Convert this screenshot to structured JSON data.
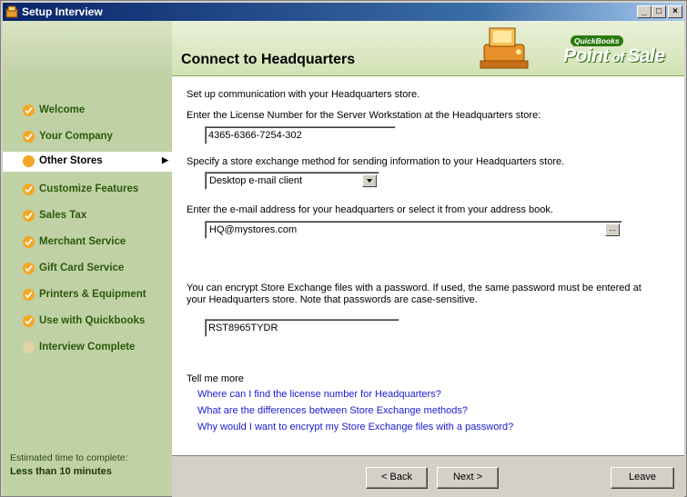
{
  "window": {
    "title": "Setup Interview",
    "minimize": "_",
    "maximize": "□",
    "close": "×"
  },
  "sidebar": {
    "items": [
      {
        "label": "Welcome",
        "state": "done"
      },
      {
        "label": "Your Company",
        "state": "done"
      },
      {
        "label": "Other Stores",
        "state": "active"
      },
      {
        "label": "Customize Features",
        "state": "done"
      },
      {
        "label": "Sales Tax",
        "state": "done"
      },
      {
        "label": "Merchant Service",
        "state": "done"
      },
      {
        "label": "Gift Card Service",
        "state": "done"
      },
      {
        "label": "Printers & Equipment",
        "state": "done"
      },
      {
        "label": "Use with Quickbooks",
        "state": "done"
      },
      {
        "label": "Interview Complete",
        "state": "pending"
      }
    ],
    "estimate_label": "Estimated time to complete:",
    "estimate_value": "Less than 10 minutes"
  },
  "header": {
    "title": "Connect to Headquarters",
    "brand_top": "QuickBooks",
    "brand_main_1": "Point",
    "brand_main_2": " of ",
    "brand_main_3": "Sale"
  },
  "main": {
    "intro": "Set up communication with your Headquarters store.",
    "license_label": "Enter the License Number for the Server Workstation at the Headquarters store:",
    "license_value": "4365-6366-7254-302",
    "method_label": "Specify a store exchange  method for sending information to your Headquarters store.",
    "method_value": "Desktop e-mail client",
    "email_label": "Enter the e-mail address for your headquarters or select it from your address book.",
    "email_value": "HQ@mystores.com",
    "browse_label": "...",
    "encrypt_line1": "You can encrypt Store Exchange files with a password. If used, the same password must be entered at",
    "encrypt_line2": "your Headquarters store. Note that passwords are case-sensitive.",
    "password_value": "RST8965TYDR",
    "tell_more": "Tell me more",
    "links": [
      "Where can I find the license number for Headquarters?",
      "What are the differences between Store Exchange methods?",
      "Why would I want to encrypt my Store Exchange files with a password?"
    ]
  },
  "footer": {
    "back": "< Back",
    "next": "Next >",
    "leave": "Leave"
  },
  "colors": {
    "sidebar_bg": "#c1d1a6",
    "nav_text": "#2a5a0a",
    "check_dot": "#f5a623",
    "link": "#1a1ad0",
    "title_bar": "#0a246a"
  }
}
